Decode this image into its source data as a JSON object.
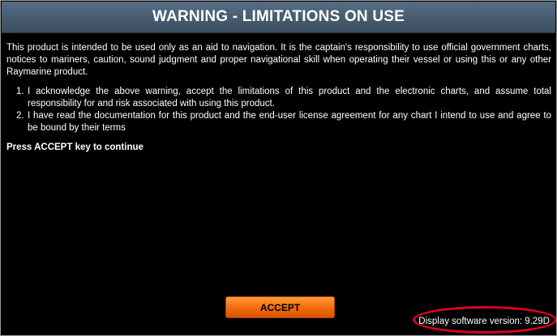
{
  "header": {
    "title": "WARNING - LIMITATIONS ON USE"
  },
  "body": {
    "intro": "This product is intended to be used only as an aid to navigation. It is the captain's responsibility to use official government charts, notices to mariners, caution, sound judgment and proper navigational skill when operating their vessel or using this or any other Raymarine product.",
    "items": [
      {
        "number": "1.",
        "text": "I acknowledge the above warning, accept the limitations of this product and the electronic charts, and assume total responsibility for and risk associated with using this product."
      },
      {
        "number": "2.",
        "text": "I have read the documentation for this product and the end-user license agreement for any chart I intend to use and agree to be bound by their terms"
      }
    ],
    "instruction": "Press ACCEPT key to continue"
  },
  "accept_button": {
    "label": "ACCEPT"
  },
  "footer": {
    "version_text": "Display software version: 9.29D"
  },
  "colors": {
    "background": "#000000",
    "title_bar": "#4a5f75",
    "button": "#f26a0c",
    "highlight": "#e0001b"
  }
}
